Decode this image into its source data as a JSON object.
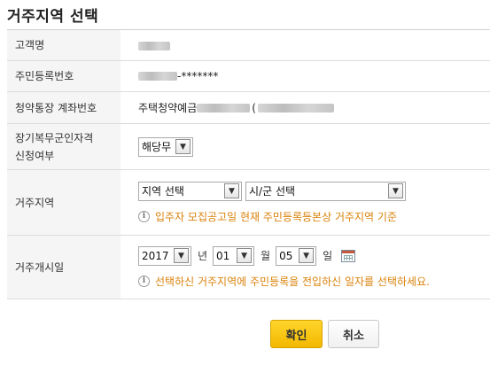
{
  "page": {
    "title": "거주지역 선택"
  },
  "rows": {
    "customer_name": {
      "label": "고객명"
    },
    "resident_no": {
      "label": "주민등록번호",
      "masked_suffix": "-*******"
    },
    "account": {
      "label": "청약통장 계좌번호",
      "product": "주택청약예금",
      "paren": "("
    },
    "long_service": {
      "label_line1": "장기복무군인자격",
      "label_line2": "신청여부",
      "value": "해당무"
    },
    "region": {
      "label": "거주지역",
      "province_value": "지역 선택",
      "city_value": "시/군 선택",
      "notice": "입주자 모집공고일 현재 주민등록등본상 거주지역 기준"
    },
    "start_date": {
      "label": "거주개시일",
      "year": "2017",
      "year_unit": "년",
      "month": "01",
      "month_unit": "월",
      "day": "05",
      "day_unit": "일",
      "notice": "선택하신 거주지역에 주민등록을 전입하신 일자를 선택하세요."
    }
  },
  "buttons": {
    "confirm": "확인",
    "cancel": "취소"
  },
  "icons": {
    "dropdown": "chevron-down-icon",
    "info": "info-icon",
    "calendar": "calendar-icon"
  },
  "colors": {
    "notice": "#d9820b",
    "confirm_button": "#f5bf00",
    "label_bg": "#f5f5f5"
  }
}
